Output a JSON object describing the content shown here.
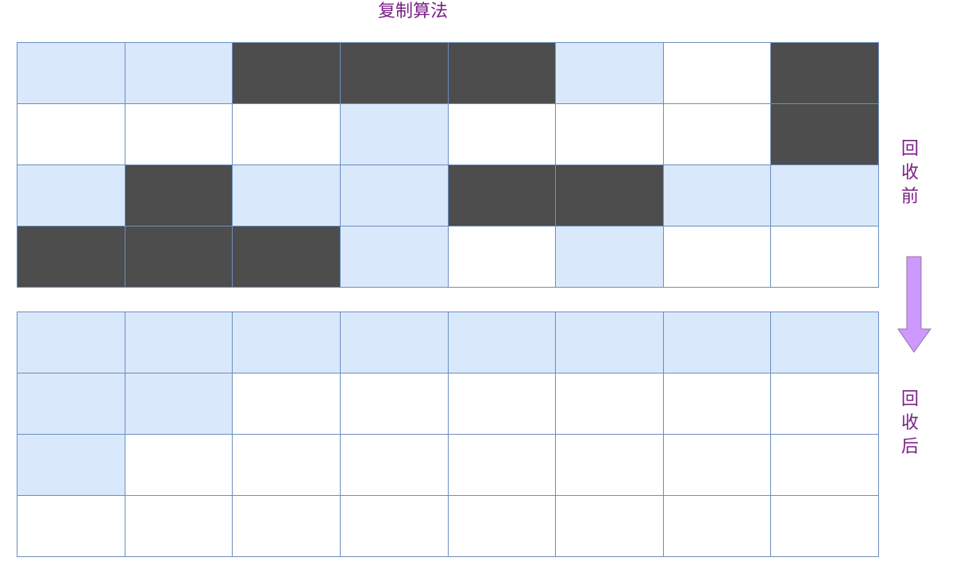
{
  "title": "复制算法",
  "labels": {
    "before": [
      "回",
      "收",
      "前"
    ],
    "after": [
      "回",
      "收",
      "后"
    ]
  },
  "colors": {
    "free": "#ffffff",
    "alive": "#dae8fc",
    "garbage": "#4d4d4d",
    "border": "#6c8ebf",
    "text": "#7a1f86",
    "arrow": "#cc99ff"
  },
  "legend_states": {
    "0": "free",
    "1": "alive",
    "2": "garbage"
  },
  "grids": {
    "before": [
      [
        1,
        1,
        2,
        2,
        2,
        1,
        0,
        2
      ],
      [
        0,
        0,
        0,
        1,
        0,
        0,
        0,
        2
      ],
      [
        1,
        2,
        1,
        1,
        2,
        2,
        1,
        1
      ],
      [
        2,
        2,
        2,
        1,
        0,
        1,
        0,
        0
      ]
    ],
    "after": [
      [
        1,
        1,
        1,
        1,
        1,
        1,
        1,
        1
      ],
      [
        1,
        1,
        0,
        0,
        0,
        0,
        0,
        0
      ],
      [
        1,
        0,
        0,
        0,
        0,
        0,
        0,
        0
      ],
      [
        0,
        0,
        0,
        0,
        0,
        0,
        0,
        0
      ]
    ]
  },
  "arrow_icon": "down-arrow-icon"
}
